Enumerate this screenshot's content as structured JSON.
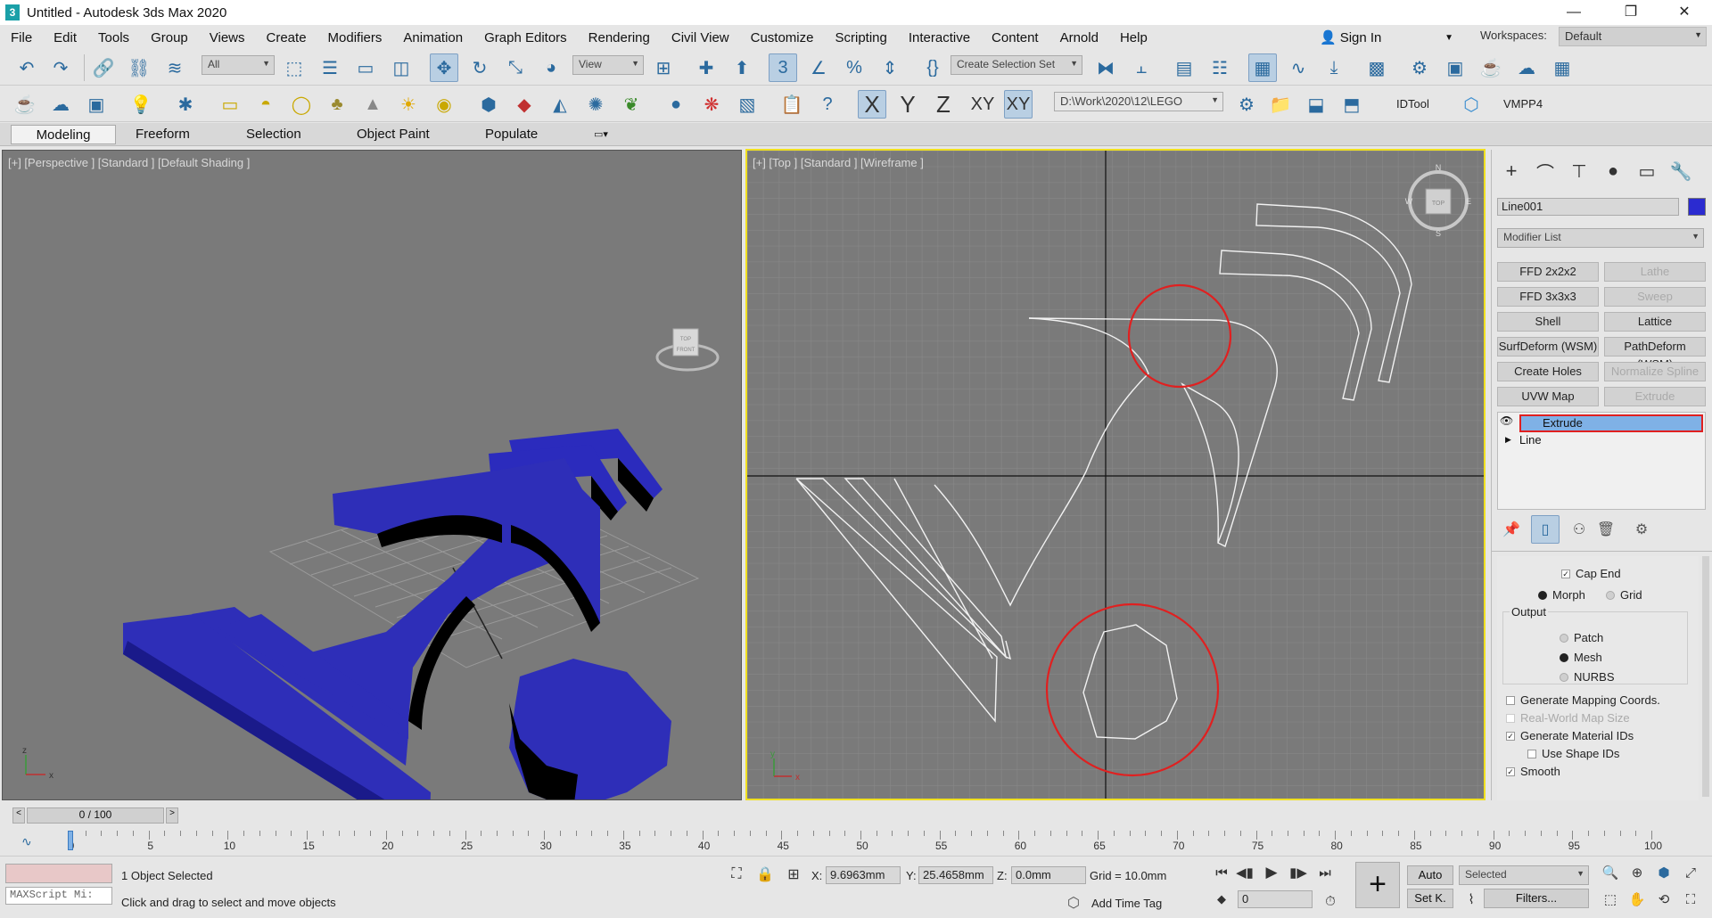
{
  "window": {
    "title": "Untitled - Autodesk 3ds Max 2020",
    "app_badge": "3"
  },
  "menu": [
    "File",
    "Edit",
    "Tools",
    "Group",
    "Views",
    "Create",
    "Modifiers",
    "Animation",
    "Graph Editors",
    "Rendering",
    "Civil View",
    "Customize",
    "Scripting",
    "Interactive",
    "Content",
    "Arnold",
    "Help"
  ],
  "account": {
    "sign_in": "Sign In",
    "workspaces_label": "Workspaces:",
    "workspace": "Default"
  },
  "toolbar": {
    "filter_dd": "All",
    "ref_coord_dd": "View",
    "selection_set_dd": "Create Selection Set",
    "axis_x": "X",
    "axis_y": "Y",
    "axis_z": "Z",
    "axis_xy": "XY",
    "axis_xy2": "XY",
    "project_path": "D:\\Work\\2020\\12\\LEGO",
    "idtool": "IDTool",
    "vmpp4": "VMPP4"
  },
  "ribbon": {
    "tabs": [
      "Modeling",
      "Freeform",
      "Selection",
      "Object Paint",
      "Populate"
    ],
    "active": "Modeling"
  },
  "viewports": {
    "left_label": "[+] [Perspective ] [Standard ] [Default Shading ]",
    "right_label": "[+] [Top ] [Standard ] [Wireframe ]",
    "nav_top": "TOP",
    "nav_front": "FRONT",
    "compass": {
      "n": "N",
      "s": "S",
      "e": "E",
      "w": "W"
    },
    "axes": {
      "x": "x",
      "y": "y",
      "z": "z"
    }
  },
  "colors": {
    "object_blue": "#2e2eb8",
    "active_border": "#f0e020",
    "highlight_red": "#e02020",
    "select_blue": "#7fb1e6"
  },
  "command_panel": {
    "object_name": "Line001",
    "object_color": "#2b2bd0",
    "modifier_list_label": "Modifier List",
    "modifier_buttons": [
      {
        "label": "FFD 2x2x2",
        "enabled": true
      },
      {
        "label": "Lathe",
        "enabled": false
      },
      {
        "label": "FFD 3x3x3",
        "enabled": true
      },
      {
        "label": "Sweep",
        "enabled": false
      },
      {
        "label": "Shell",
        "enabled": true
      },
      {
        "label": "Lattice",
        "enabled": true
      },
      {
        "label": "SurfDeform (WSM)",
        "enabled": true
      },
      {
        "label": "PathDeform (WSM)",
        "enabled": true
      },
      {
        "label": "Create Holes",
        "enabled": true
      },
      {
        "label": "Normalize Spline",
        "enabled": false
      },
      {
        "label": "UVW Map",
        "enabled": true
      },
      {
        "label": "Extrude",
        "enabled": false
      }
    ],
    "stack": [
      {
        "label": "Extrude",
        "selected": true
      },
      {
        "label": "Line",
        "selected": false
      }
    ],
    "params": {
      "cap_end": "Cap End",
      "morph": "Morph",
      "grid": "Grid",
      "output_label": "Output",
      "patch": "Patch",
      "mesh": "Mesh",
      "nurbs": "NURBS",
      "gen_mapping": "Generate Mapping Coords.",
      "real_world": "Real-World Map Size",
      "gen_material": "Generate Material IDs",
      "use_shape": "Use Shape IDs",
      "smooth": "Smooth"
    }
  },
  "timeline": {
    "frame_counter": "0 / 100",
    "ticks": [
      "0",
      "5",
      "10",
      "15",
      "20",
      "25",
      "30",
      "35",
      "40",
      "45",
      "50",
      "55",
      "60",
      "65",
      "70",
      "75",
      "80",
      "85",
      "90",
      "95",
      "100"
    ]
  },
  "status": {
    "maxscript_placeholder": "MAXScript Mi:",
    "selection_info": "1 Object Selected",
    "prompt": "Click and drag to select and move objects",
    "x_label": "X:",
    "x_value": "9.6963mm",
    "y_label": "Y:",
    "y_value": "25.4658mm",
    "z_label": "Z:",
    "z_value": "0.0mm",
    "grid": "Grid = 10.0mm",
    "add_time_tag": "Add Time Tag",
    "auto": "Auto",
    "set_key": "Set K.",
    "selected_dd": "Selected",
    "filters": "Filters...",
    "frame_field": "0"
  }
}
